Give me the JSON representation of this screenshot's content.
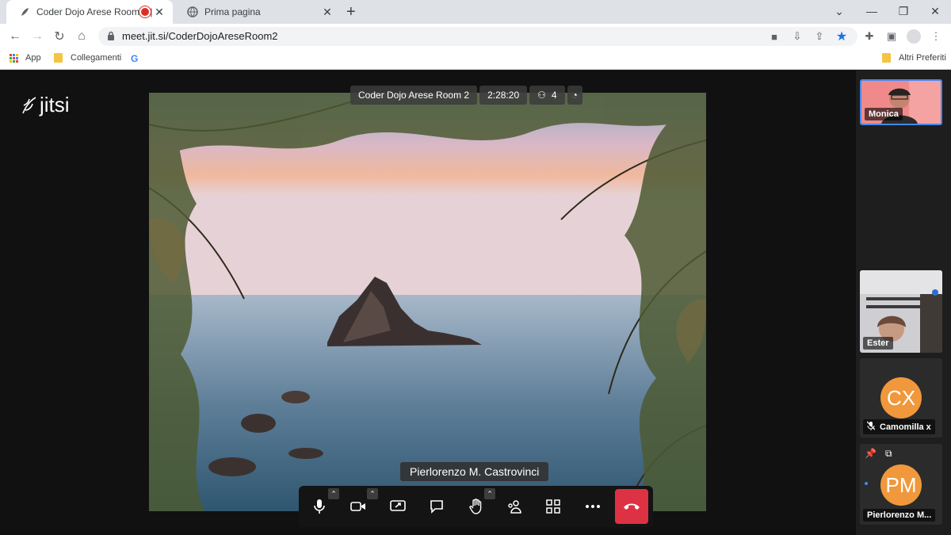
{
  "browser": {
    "tabs": [
      {
        "title": "Coder Dojo Arese Room 2 |",
        "recording": true
      },
      {
        "title": "Prima pagina"
      }
    ],
    "new_tab_symbol": "+",
    "window_controls": [
      "chevron-down-icon",
      "minimize-icon",
      "restore-icon",
      "close-icon"
    ],
    "url": "meet.jit.si/CoderDojoAreseRoom2",
    "bookmarks": [
      {
        "label": "App",
        "icon": "apps-grid-icon"
      },
      {
        "label": "Collegamenti",
        "icon": "folder-icon"
      },
      {
        "label": "G",
        "icon": "google-icon"
      }
    ],
    "other_bookmarks": "Altri Preferiti"
  },
  "meeting": {
    "logo": "jitsi",
    "room_name": "Coder Dojo Arese Room 2",
    "duration": "2:28:20",
    "participant_count": "4",
    "dominant_speaker": "Pierlorenzo M. Castrovinci",
    "participants": [
      {
        "name": "Monica",
        "type": "video"
      },
      {
        "name": "Ester",
        "type": "video"
      },
      {
        "name": "Camomilla x",
        "initials": "CX",
        "muted": true
      },
      {
        "name": "Pierlorenzo M...",
        "initials": "PM",
        "pinned": true
      }
    ],
    "colors": {
      "hangup": "#dd3243",
      "avatar": "#f0983b",
      "active_border": "#4687ed"
    }
  }
}
